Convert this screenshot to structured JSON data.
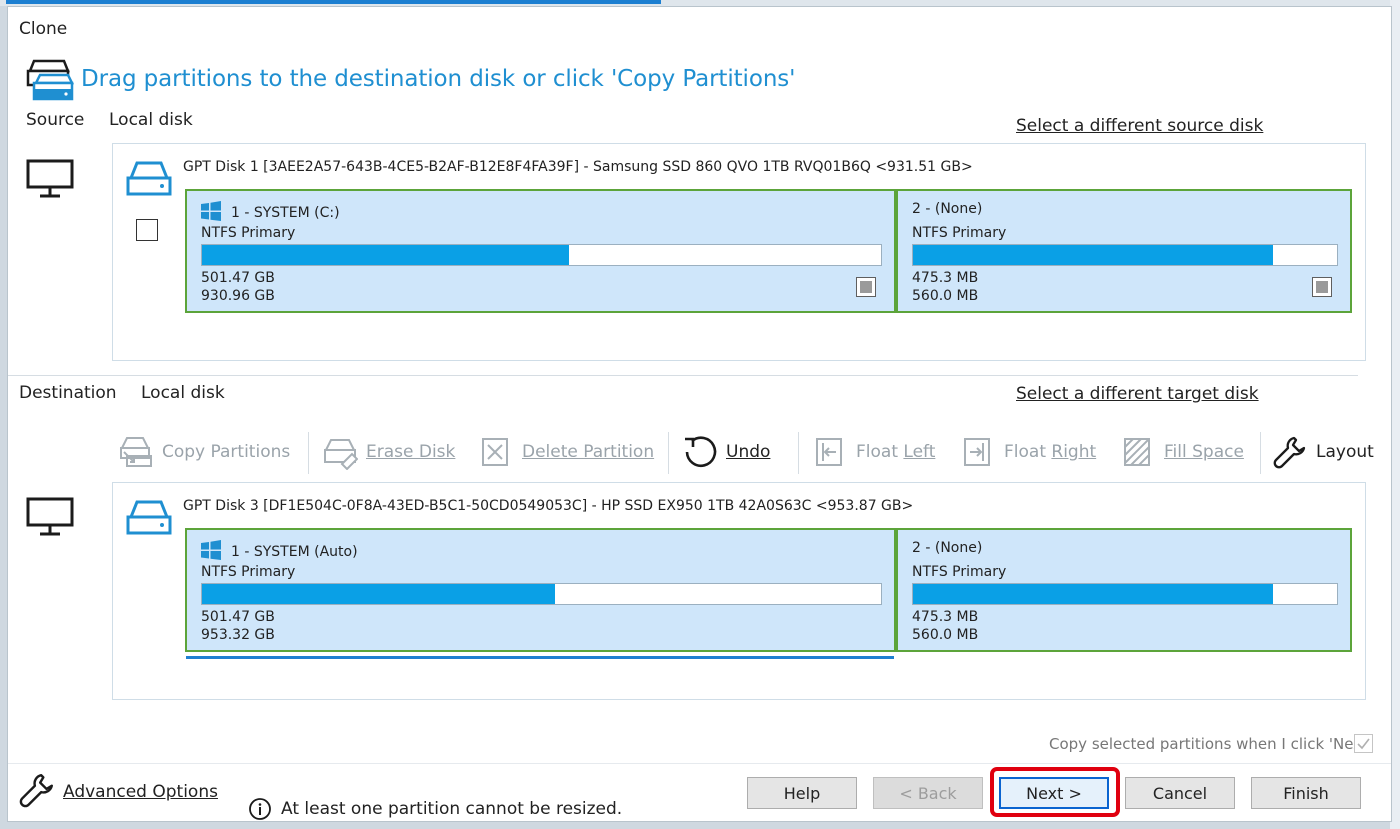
{
  "window": {
    "title": "Clone"
  },
  "header": {
    "text": "Drag partitions to the destination disk or click 'Copy Partitions'"
  },
  "source": {
    "label": "Source",
    "disk_type": "Local disk",
    "select_link": "Select a different source disk",
    "disk_title": "GPT Disk 1 [3AEE2A57-643B-4CE5-B2AF-B12E8F4FA39F] - Samsung SSD 860 QVO 1TB RVQ01B6Q  <931.51 GB>",
    "partitions": [
      {
        "name": "1 - SYSTEM (C:)",
        "type": "NTFS Primary",
        "used": "501.47 GB",
        "total": "930.96 GB",
        "fill": 0.54,
        "icon": "windows-icon"
      },
      {
        "name": "2 -  (None)",
        "type": "NTFS Primary",
        "used": "475.3 MB",
        "total": "560.0 MB",
        "fill": 0.85
      }
    ]
  },
  "destination": {
    "label": "Destination",
    "disk_type": "Local disk",
    "select_link": "Select a different target disk",
    "disk_title": "GPT Disk 3 [DF1E504C-0F8A-43ED-B5C1-50CD0549053C] - HP SSD EX950 1TB 42A0S63C  <953.87 GB>",
    "partitions": [
      {
        "name": "1 - SYSTEM (Auto)",
        "type": "NTFS Primary",
        "used": "501.47 GB",
        "total": "953.32 GB",
        "fill": 0.52,
        "icon": "windows-icon"
      },
      {
        "name": "2 -  (None)",
        "type": "NTFS Primary",
        "used": "475.3 MB",
        "total": "560.0 MB",
        "fill": 0.85
      }
    ]
  },
  "toolbar": {
    "copy_partitions": "Copy Partitions",
    "erase_disk": "Erase Disk",
    "delete_partition": "Delete Partition",
    "undo": "Undo",
    "float_left": "Float Left",
    "float_right": "Float Right",
    "fill_space": "Fill Space",
    "layout": "Layout"
  },
  "footer": {
    "copy_selected_text": "Copy selected partitions when I click 'Next'",
    "advanced_options": "Advanced Options",
    "info_text": "At least one partition cannot be resized.",
    "buttons": {
      "help": "Help",
      "back": "< Back",
      "next": "Next >",
      "cancel": "Cancel",
      "finish": "Finish"
    }
  },
  "colors": {
    "accent": "#1f8fd1",
    "partition_fill": "#0aa0e6",
    "partition_bg": "#cfe6fa",
    "partition_border": "#5ca43a",
    "highlight": "#e0000f"
  }
}
